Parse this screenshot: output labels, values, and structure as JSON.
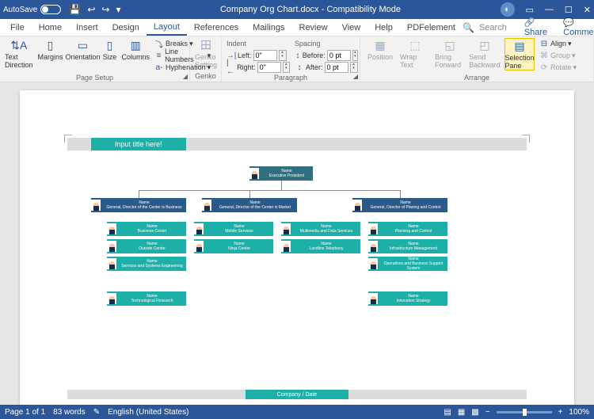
{
  "titlebar": {
    "autosave": "AutoSave",
    "title": "Company Org Chart.docx  -  Compatibility Mode"
  },
  "tabs": {
    "items": [
      "File",
      "Home",
      "Insert",
      "Design",
      "Layout",
      "References",
      "Mailings",
      "Review",
      "View",
      "Help",
      "PDFelement"
    ],
    "search": "Search",
    "share": "Share",
    "comments": "Comments"
  },
  "ribbon": {
    "pagesetup": {
      "textdir": "Text Direction",
      "margins": "Margins",
      "orientation": "Orientation",
      "size": "Size",
      "columns": "Columns",
      "breaks": "Breaks",
      "linenumbers": "Line Numbers",
      "hyphenation": "Hyphenation",
      "label": "Page Setup"
    },
    "genko": {
      "btn": "Genko Setting",
      "label": "Genko"
    },
    "paragraph": {
      "indent": "Indent",
      "spacing": "Spacing",
      "left": "Left:",
      "right": "Right:",
      "before": "Before:",
      "after": "After:",
      "leftval": "0\"",
      "rightval": "0\"",
      "beforeval": "0 pt",
      "afterval": "0 pt",
      "label": "Paragraph"
    },
    "arrange": {
      "position": "Position",
      "wrap": "Wrap Text",
      "bringfwd": "Bring Forward",
      "sendback": "Send Backward",
      "selpane": "Selection Pane",
      "align": "Align",
      "group": "Group",
      "rotate": "Rotate",
      "label": "Arrange"
    }
  },
  "doc": {
    "title_placeholder": "Input title here!",
    "footer": "Company  / Date",
    "nodes": {
      "name": "Name",
      "top": "Executive President",
      "d1": "General, Director of the Center is Business",
      "d2": "General, Director of the Center is Market",
      "d3": "General, Director of Planing and Control",
      "a1": "Business Center",
      "a2": "Outside Center",
      "a3": "Services and Systems Engineering",
      "a4": "Technological Research",
      "b1": "Mobile Services",
      "b2": "Ninja Center",
      "c1": "Multimedia and Data Services",
      "c2": "Landline Telephony",
      "e1": "Planning and Control",
      "e2": "Infrastructure Management",
      "e3": "Operations and Business Support System",
      "e4": "Innovation Strategy"
    }
  },
  "status": {
    "page": "Page 1 of 1",
    "words": "83 words",
    "lang": "English (United States)",
    "zoom": "100%"
  }
}
